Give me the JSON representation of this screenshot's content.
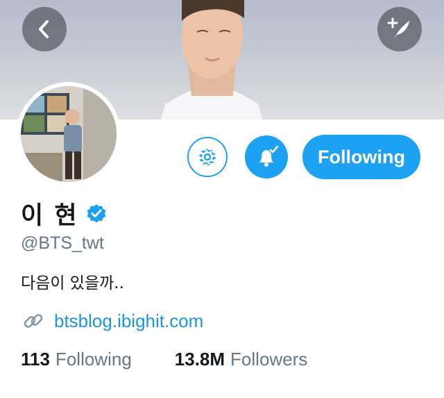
{
  "header": {
    "back_icon": "chevron-left-icon",
    "compose_icon": "compose-tweet-icon"
  },
  "actions": {
    "settings_icon": "gear-icon",
    "notifications_icon": "bell-check-icon",
    "follow_label": "Following"
  },
  "profile": {
    "name": "이 현",
    "verified": true,
    "handle": "@BTS_twt",
    "bio": "다음이 있을까..",
    "website": "btsblog.ibighit.com"
  },
  "stats": {
    "following_count": "113",
    "following_label": "Following",
    "followers_count": "13.8M",
    "followers_label": "Followers"
  },
  "colors": {
    "accent": "#1da1f2",
    "link": "#1b95e0",
    "text": "#14171a",
    "muted": "#657786"
  }
}
